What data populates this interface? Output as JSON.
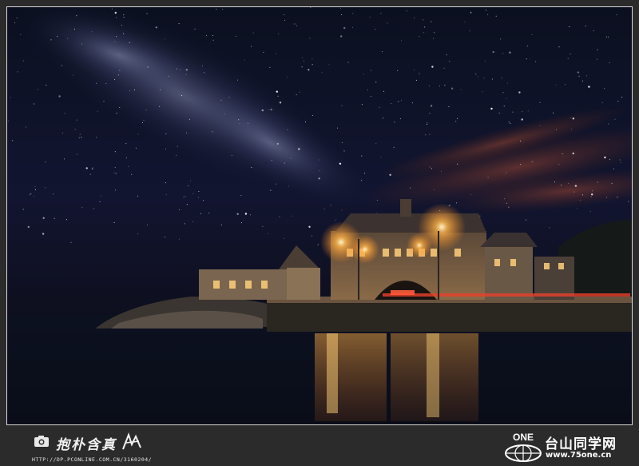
{
  "photo": {
    "subject": "milky-way-night-sky-over-lit-stone-building-by-water",
    "colors": {
      "sky_top": "#0c1022",
      "sky_mid": "#141733",
      "horizon_glow": "#7a3a2a",
      "lamp": "#ffb347",
      "water": "#0a0e1a"
    }
  },
  "watermark": {
    "author_name": "抱朴含真",
    "author_url": "HTTP://DP.PCONLINE.COM.CN/3160204/",
    "logo_text": "ONE",
    "site_name": "台山同学网",
    "site_url": "www.75one.cn"
  }
}
